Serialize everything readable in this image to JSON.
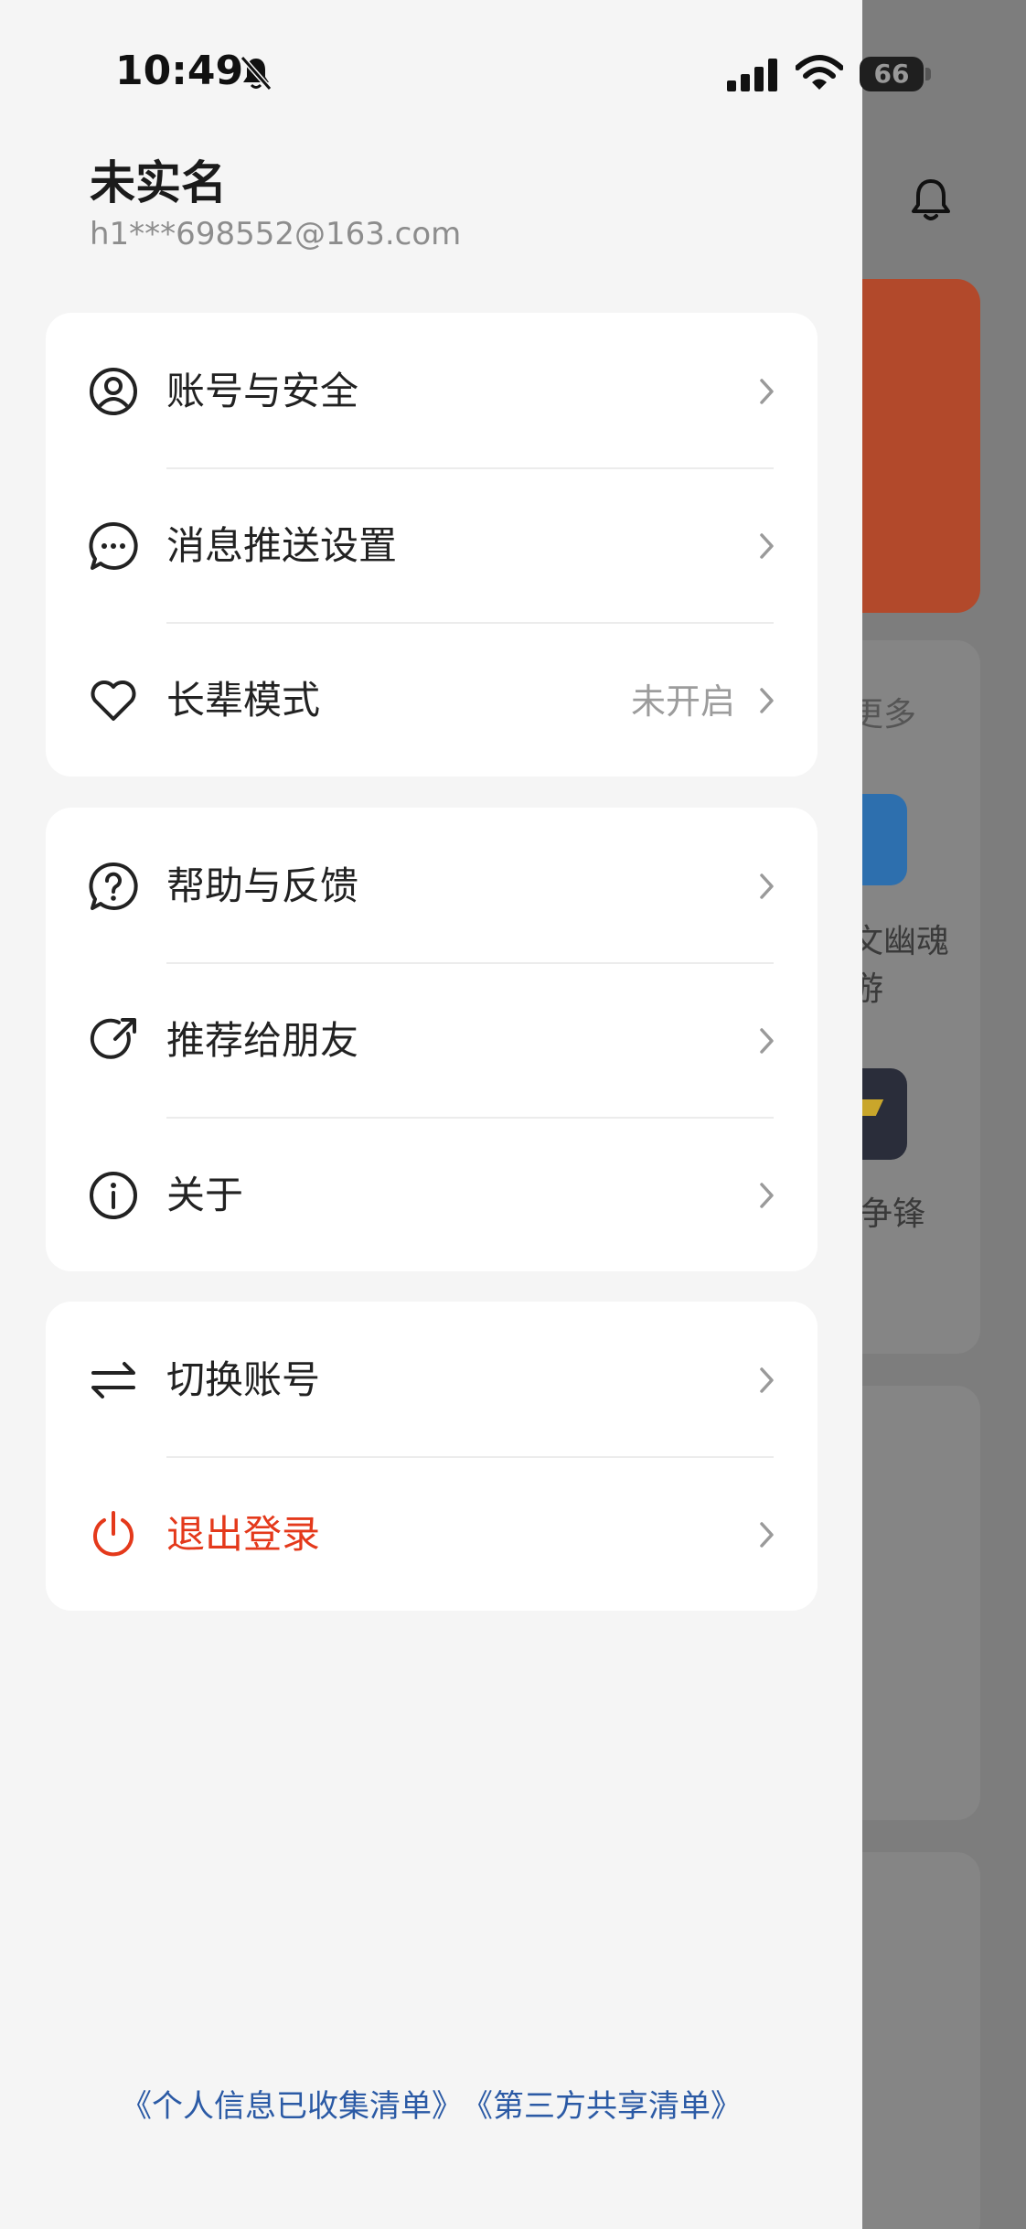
{
  "status_bar": {
    "time": "10:49",
    "battery": "66"
  },
  "user": {
    "name": "未实名",
    "email": "h1***698552@163.com"
  },
  "menu_groups": [
    {
      "items": [
        {
          "label": "账号与安全",
          "icon": "user-circle-icon",
          "value": ""
        },
        {
          "label": "消息推送设置",
          "icon": "message-bubble-icon",
          "value": ""
        },
        {
          "label": "长辈模式",
          "icon": "heart-icon",
          "value": "未开启"
        }
      ]
    },
    {
      "items": [
        {
          "label": "帮助与反馈",
          "icon": "help-bubble-icon",
          "value": ""
        },
        {
          "label": "推荐给朋友",
          "icon": "share-icon",
          "value": ""
        },
        {
          "label": "关于",
          "icon": "info-icon",
          "value": ""
        }
      ]
    },
    {
      "items": [
        {
          "label": "切换账号",
          "icon": "switch-icon",
          "value": ""
        },
        {
          "label": "退出登录",
          "icon": "power-icon",
          "value": "",
          "danger": true
        }
      ]
    }
  ],
  "footer": {
    "privacy_link": "《个人信息已收集清单》",
    "third_party_link": "《第三方共享清单》"
  },
  "background": {
    "more": "更多",
    "game1_line1": "文幽魂",
    "game1_line2": "游",
    "game2": "争锋"
  },
  "colors": {
    "danger": "#e4391b",
    "link": "#2b5aa5",
    "banner": "#b2492b"
  }
}
